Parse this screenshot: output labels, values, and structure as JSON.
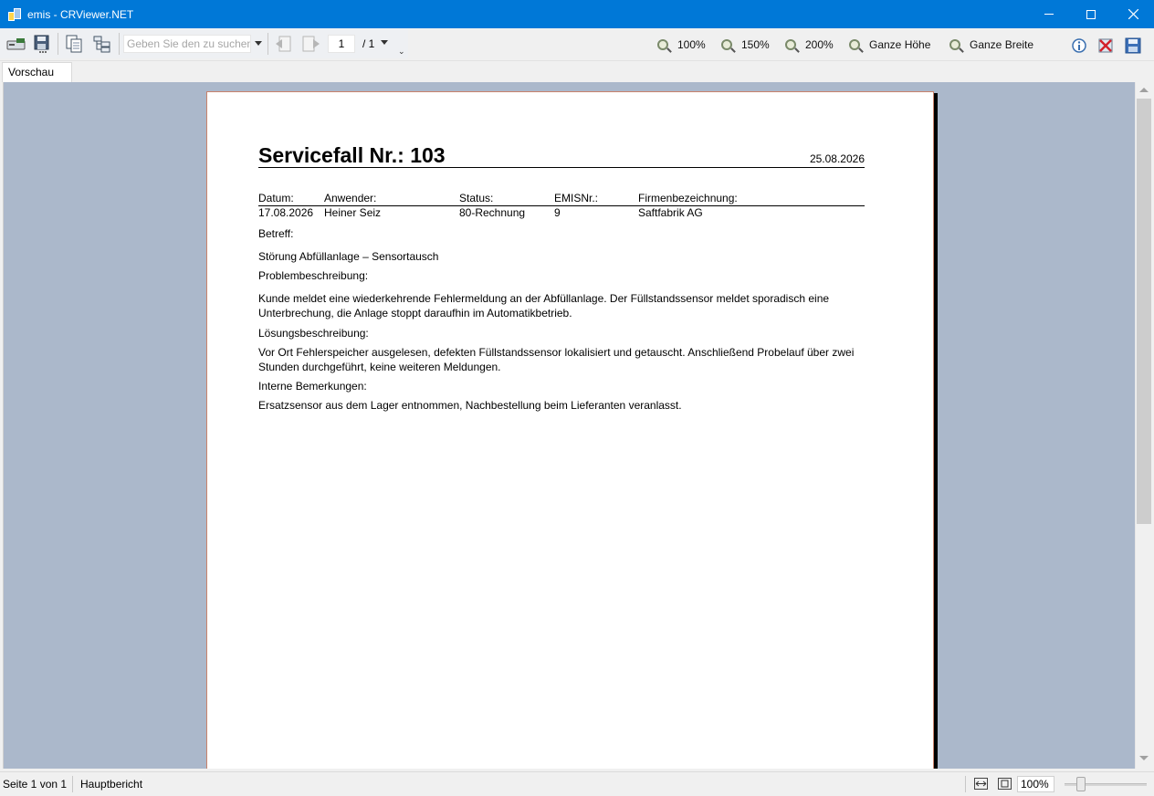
{
  "window": {
    "title": "emis - CRViewer.NET",
    "controls": {
      "minimize": "minimize-icon",
      "maximize": "maximize-icon",
      "close": "close-icon"
    }
  },
  "toolbar": {
    "search_placeholder": "Geben Sie den zu suchenden Text ein",
    "current_page": "1",
    "total_pages": "/ 1",
    "more": "⌄",
    "zoom_buttons": [
      {
        "label": "100%"
      },
      {
        "label": "150%"
      },
      {
        "label": "200%"
      },
      {
        "label": "Ganze Höhe"
      },
      {
        "label": "Ganze Breite"
      }
    ]
  },
  "tabs": [
    {
      "label": "Vorschau",
      "active": true
    }
  ],
  "report": {
    "title": "Servicefall Nr.: 103",
    "date": "25.08.2026",
    "headers": {
      "datum": "Datum:",
      "anwender": "Anwender:",
      "status": "Status:",
      "emisnr": "EMISNr.:",
      "firma": "Firmenbezeichnung:"
    },
    "values": {
      "datum": "17.08.2026",
      "anwender": "Heiner Seiz",
      "status": "80-Rechnung",
      "emisnr": "9",
      "firma": "Saftfabrik AG"
    },
    "betreff_label": "Betreff:",
    "betreff": "Störung Abfüllanlage – Sensortausch",
    "problem_label": "Problembeschreibung:",
    "problem": "Kunde meldet eine wiederkehrende Fehlermeldung an der Abfüllanlage. Der Füllstandssensor meldet sporadisch eine Unterbrechung, die Anlage stoppt daraufhin im Automatikbetrieb.",
    "loesung_label": "Lösungsbeschreibung:",
    "loesung": "Vor Ort Fehlerspeicher ausgelesen, defekten Füllstandssensor lokalisiert und getauscht. Anschließend Probelauf über zwei Stunden durchgeführt, keine weiteren Meldungen.",
    "intern_label": "Interne Bemerkungen:",
    "intern": "Ersatzsensor aus dem Lager entnommen, Nachbestellung beim Lieferanten veranlasst."
  },
  "statusbar": {
    "page_info": "Seite 1 von 1",
    "report_name": "Hauptbericht",
    "zoom_value": "100%"
  },
  "colors": {
    "titlebar": "#0078d7",
    "preview_bg": "#abb8cb",
    "page_border": "#c9826b"
  }
}
